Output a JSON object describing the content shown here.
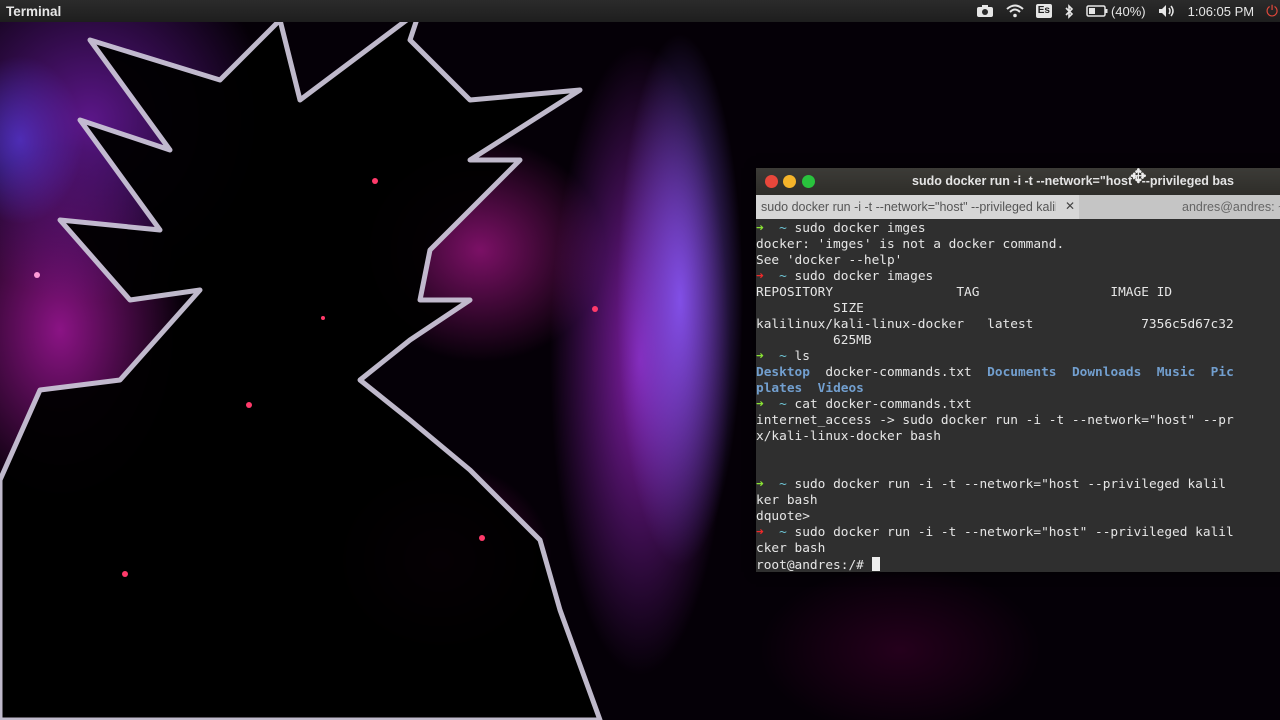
{
  "top_panel": {
    "app_title": "Terminal",
    "keyboard_layout": "Es",
    "battery": "(40%)",
    "clock": "1:06:05 PM"
  },
  "terminal": {
    "window_title": "sudo docker run -i -t --network=\"host\" --privileged  bas",
    "tabs": [
      {
        "label": "sudo docker run -i -t --network=\"host\" --privileged kalilinux/kali-linux-docker bash"
      },
      {
        "label": "andres@andres: ~"
      }
    ],
    "lines": [
      {
        "prompt": "ok",
        "cmd": "sudo docker imges"
      },
      {
        "text": "docker: 'imges' is not a docker command."
      },
      {
        "text": "See 'docker --help'"
      },
      {
        "prompt": "err",
        "cmd": "sudo docker images"
      },
      {
        "text": "REPOSITORY                TAG                 IMAGE ID    "
      },
      {
        "text": "          SIZE"
      },
      {
        "text": "kalilinux/kali-linux-docker   latest              7356c5d67c32"
      },
      {
        "text": "          625MB"
      },
      {
        "prompt": "ok",
        "cmd": "ls"
      },
      {
        "ls": [
          "Desktop",
          "docker-commands.txt",
          "Documents",
          "Downloads",
          "Music",
          "Pic"
        ]
      },
      {
        "ls2": [
          "plates",
          "Videos"
        ]
      },
      {
        "prompt": "ok",
        "cmd": "cat docker-commands.txt"
      },
      {
        "text": "internet_access -> sudo docker run -i -t --network=\"host\" --pr"
      },
      {
        "text": "x/kali-linux-docker bash"
      },
      {
        "text": ""
      },
      {
        "text": ""
      },
      {
        "prompt": "ok",
        "cmd": "sudo docker run -i -t --network=\"host --privileged kalil"
      },
      {
        "text": "ker bash"
      },
      {
        "text": "dquote>"
      },
      {
        "prompt": "err",
        "cmd": "sudo docker run -i -t --network=\"host\" --privileged kalil"
      },
      {
        "text": "cker bash"
      },
      {
        "text": "root@andres:/# "
      }
    ]
  }
}
